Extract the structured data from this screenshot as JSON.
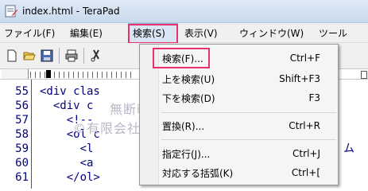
{
  "window": {
    "title": "index.html - TeraPad"
  },
  "menubar": {
    "items": [
      "ファイル(F)",
      "編集(E)",
      "検索(S)",
      "表示(V)",
      "ウィンドウ(W)",
      "ツール"
    ],
    "open_index": 2
  },
  "ruler": {
    "mark_label": "0"
  },
  "editor": {
    "line_numbers": [
      "55",
      "56",
      "57",
      "58",
      "59",
      "60",
      "61"
    ],
    "lines": [
      "<div clas",
      "  <div c",
      "    <!--",
      "    <ol c",
      "      <l",
      "      <a",
      "    </ol>"
    ],
    "trailing_fragment": "ム"
  },
  "watermark": {
    "line1": "無断転載禁止",
    "line2": "©有限会社ガシステム"
  },
  "search_menu": {
    "items": [
      {
        "label": "検索(F)...",
        "shortcut": "Ctrl+F"
      },
      {
        "label": "上を検索(U)",
        "shortcut": "Shift+F3"
      },
      {
        "label": "下を検索(D)",
        "shortcut": "F3"
      },
      {
        "label": "置換(R)...",
        "shortcut": "Ctrl+R"
      },
      {
        "label": "指定行(J)...",
        "shortcut": "Ctrl+J"
      },
      {
        "label": "対応する括弧(K)",
        "shortcut": "Ctrl+["
      }
    ]
  },
  "colors": {
    "highlight_border": "#e8326f",
    "code_text": "#000080",
    "menu_bg": "#f5f5f5"
  }
}
